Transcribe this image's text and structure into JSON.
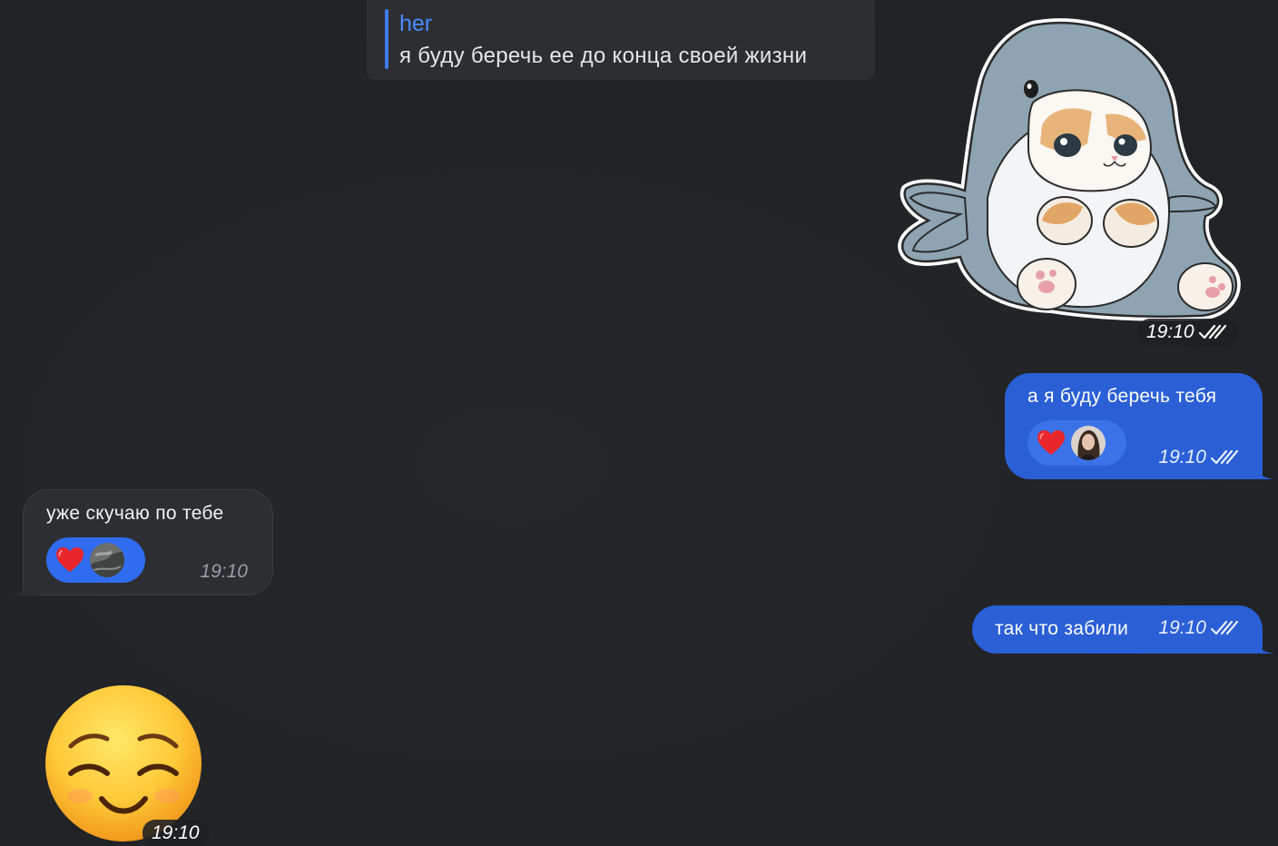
{
  "quote": {
    "author": "her",
    "text": "я буду беречь ее до конца своей жизни"
  },
  "sticker": {
    "icon": "shark-cat-sticker",
    "time": "19:10"
  },
  "messages": [
    {
      "direction": "out",
      "text": "а я буду беречь тебя",
      "time": "19:10",
      "reaction": "heart-icon"
    },
    {
      "direction": "in",
      "text": "уже скучаю по тебе",
      "time": "19:10",
      "reaction": "heart-icon"
    },
    {
      "direction": "out",
      "text": "так что забили",
      "time": "19:10"
    }
  ],
  "emoji_message": {
    "icon": "smiling-face-emoji",
    "time": "19:10"
  },
  "colors": {
    "background": "#222427",
    "outgoing_bubble": "#2a5fd6",
    "incoming_bubble": "#2c2e31",
    "accent": "#3e7cf2"
  }
}
